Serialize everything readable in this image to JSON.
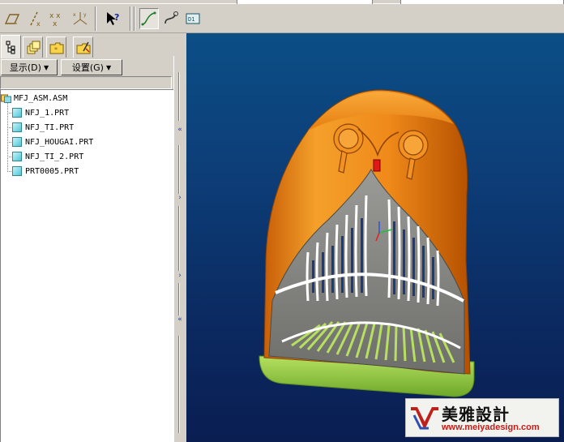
{
  "toolbar": {
    "buttons": [
      "plane-icon",
      "axis-icon",
      "point-icon",
      "csys-icon",
      "whats-this-icon",
      "sketch-curve-icon",
      "datum-curve-icon",
      "annotation-icon"
    ]
  },
  "leftpanel": {
    "tabs": [
      "model-tree-tab",
      "layers-tab",
      "folder-tab",
      "favorites-tab"
    ],
    "menu": {
      "display_label": "显示(D)",
      "settings_label": "设置(G)"
    },
    "tree": {
      "root": "MFJ_ASM.ASM",
      "items": [
        "NFJ_1.PRT",
        "NFJ_TI.PRT",
        "NFJ_HOUGAI.PRT",
        "NFJ_TI_2.PRT",
        "PRT0005.PRT"
      ]
    }
  },
  "watermark": {
    "title": "美雅設計",
    "url": "www.meiyadesign.com"
  },
  "colors": {
    "shell_orange": "#f08a1a",
    "grille_gray": "#8c8c88",
    "base_green": "#9fd24a",
    "viewport_blue": "#0d3d77"
  }
}
